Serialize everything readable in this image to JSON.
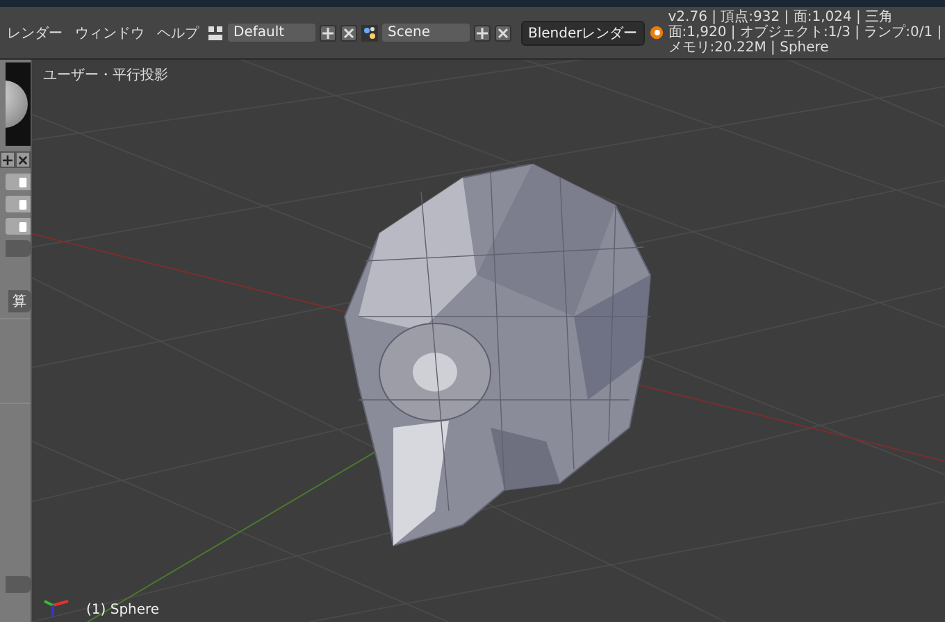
{
  "menu": [
    "レンダー",
    "ウィンドウ",
    "ヘルプ"
  ],
  "layout_field": {
    "value": "Default"
  },
  "scene_field": {
    "value": "Scene"
  },
  "render_engine": {
    "value": "Blenderレンダー"
  },
  "stats": "v2.76 | 頂点:932 | 面:1,024 | 三角面:1,920 | オブジェクト:1/3 | ランプ:0/1 | メモリ:20.22M | Sphere",
  "left_panel": {
    "button_label": "算"
  },
  "viewport": {
    "view_label": "ユーザー・平行投影",
    "object_label": "(1) Sphere"
  }
}
